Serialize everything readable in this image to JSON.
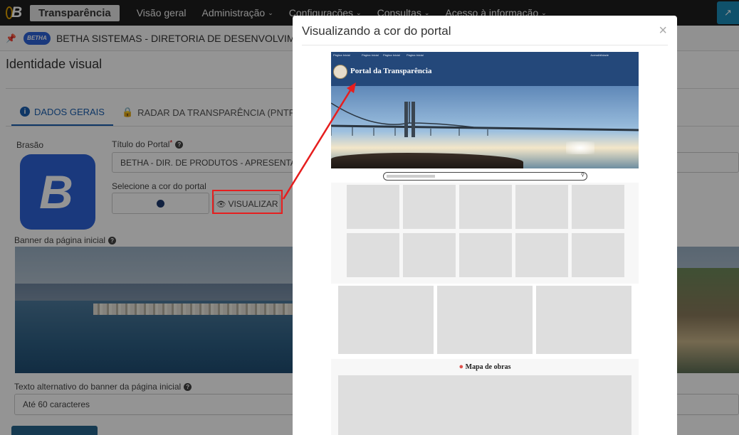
{
  "topnav": {
    "brand_name": "Transparência",
    "items": [
      {
        "label": "Visão geral",
        "has_menu": false
      },
      {
        "label": "Administração",
        "has_menu": true
      },
      {
        "label": "Configurações",
        "has_menu": true
      },
      {
        "label": "Consultas",
        "has_menu": true
      },
      {
        "label": "Acesso à informação",
        "has_menu": true
      }
    ],
    "external_link_icon": "external-link-icon"
  },
  "orgbar": {
    "logo_text": "BETHA",
    "org_name": "BETHA SISTEMAS - DIRETORIA DE DESENVOLVIMENTO - AP"
  },
  "page": {
    "title": "Identidade visual"
  },
  "tabs": [
    {
      "label": "DADOS GERAIS",
      "icon": "info-icon",
      "active": true
    },
    {
      "label": "RADAR DA TRANSPARÊNCIA (PNTP)",
      "icon": "lock-icon",
      "active": false
    }
  ],
  "form": {
    "crest_label": "Brasão",
    "crest_letter": "B",
    "portal_title_label": "Título do Portal",
    "portal_title_required_mark": "*",
    "portal_title_value": "BETHA - DIR. DE PRODUTOS - APRESENTAÇÃO",
    "color_label": "Selecione a cor do portal",
    "selected_color": "#1e3a6e",
    "visualize_button": "VISUALIZAR",
    "banner_label": "Banner da página inicial",
    "banner_alt_label": "Texto alternativo do banner da página inicial",
    "banner_alt_placeholder": "Até 60 caracteres"
  },
  "modal": {
    "title": "Visualizando a cor do portal",
    "close_symbol": "×",
    "preview": {
      "header_color": "#24487a",
      "portal_title": "Portal da Transparência",
      "top_links": [
        "Página Inicial",
        "Página Inicial",
        "Página Inicial",
        "Página Inicial"
      ],
      "accessibility_label": "Acessibilidade",
      "map_title": "Mapa de obras"
    }
  },
  "colors": {
    "accent": "#1b5fb0",
    "highlight": "#e61e1e",
    "crest_bg": "#2d63d8"
  }
}
